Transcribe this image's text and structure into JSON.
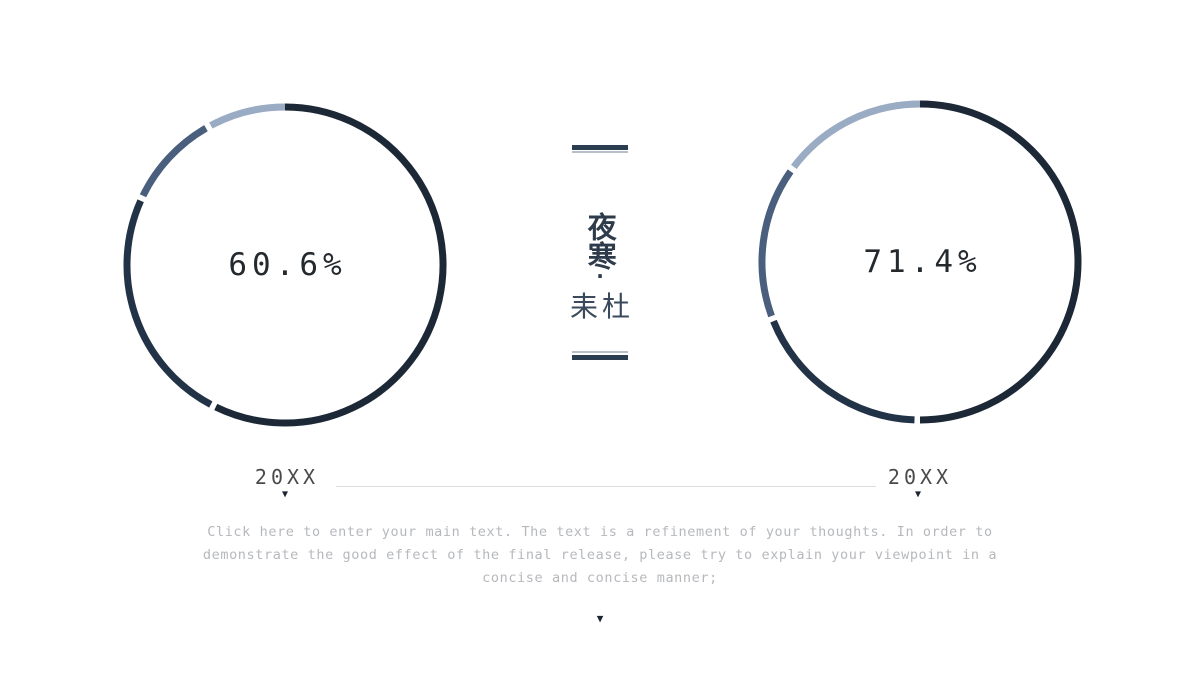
{
  "slide": {
    "background": "#ffffff"
  },
  "palette": {
    "dark_navy": "#1c2836",
    "deep_slate": "#233347",
    "mid_slate": "#4a5f7e",
    "light_blue": "#9aabc4",
    "text_dark": "#24292e",
    "text_muted": "#b6b8bc",
    "rule_gray": "#dcdde0",
    "ornament_dark": "#2b3e50",
    "ornament_light": "#b9bfc6"
  },
  "rings": [
    {
      "name": "left-ring",
      "value_label": "60.6%",
      "value": 60.6,
      "segments": [
        {
          "name": "light",
          "color": "#9aabc4",
          "start_deg": -28,
          "end_deg": 0
        },
        {
          "name": "mid",
          "color": "#4a5f7e",
          "start_deg": -64,
          "end_deg": -30
        },
        {
          "name": "deep",
          "color": "#233347",
          "start_deg": -152,
          "end_deg": -66
        },
        {
          "name": "dark",
          "color": "#1c2836",
          "start_deg": 0,
          "end_deg": 206
        }
      ]
    },
    {
      "name": "right-ring",
      "value_label": "71.4%",
      "value": 71.4,
      "segments": [
        {
          "name": "light",
          "color": "#9aabc4",
          "start_deg": -53,
          "end_deg": 0
        },
        {
          "name": "mid",
          "color": "#4a5f7e",
          "start_deg": -110,
          "end_deg": -55
        },
        {
          "name": "deep",
          "color": "#233347",
          "start_deg": -178,
          "end_deg": -112
        },
        {
          "name": "dark",
          "color": "#1c2836",
          "start_deg": 0,
          "end_deg": 180
        }
      ]
    }
  ],
  "center": {
    "main_text": "夜寒",
    "dot": "·",
    "sub_text": "耒杜",
    "top_ornament": "double-rule",
    "bottom_ornament": "double-rule"
  },
  "timeline": {
    "first_year": "20XX",
    "second_year": "20XX",
    "caret": "▼"
  },
  "body": {
    "paragraph": "Click here to enter your main text. The text is a refinement of your thoughts. In order to demonstrate the good effect of the final release, please try to explain your viewpoint in a concise and concise manner;",
    "bottom_caret": "▼"
  },
  "chart_data": {
    "type": "pie",
    "title": "",
    "charts": [
      {
        "name": "left-donut",
        "center_label": "60.6%",
        "value": 60.6,
        "unit": "%",
        "period": "20XX",
        "ring_style": "donut",
        "segments": [
          {
            "label": "segment-1-light",
            "color": "#9aabc4",
            "arc_degrees": 28
          },
          {
            "label": "segment-2-mid",
            "color": "#4a5f7e",
            "arc_degrees": 34
          },
          {
            "label": "segment-3-deep",
            "color": "#233347",
            "arc_degrees": 86
          },
          {
            "label": "segment-4-dark",
            "color": "#1c2836",
            "arc_degrees": 206
          }
        ]
      },
      {
        "name": "right-donut",
        "center_label": "71.4%",
        "value": 71.4,
        "unit": "%",
        "period": "20XX",
        "ring_style": "donut",
        "segments": [
          {
            "label": "segment-1-light",
            "color": "#9aabc4",
            "arc_degrees": 53
          },
          {
            "label": "segment-2-mid",
            "color": "#4a5f7e",
            "arc_degrees": 55
          },
          {
            "label": "segment-3-deep",
            "color": "#233347",
            "arc_degrees": 66
          },
          {
            "label": "segment-4-dark",
            "color": "#1c2836",
            "arc_degrees": 180
          }
        ]
      }
    ],
    "legend": [],
    "grid": false
  }
}
